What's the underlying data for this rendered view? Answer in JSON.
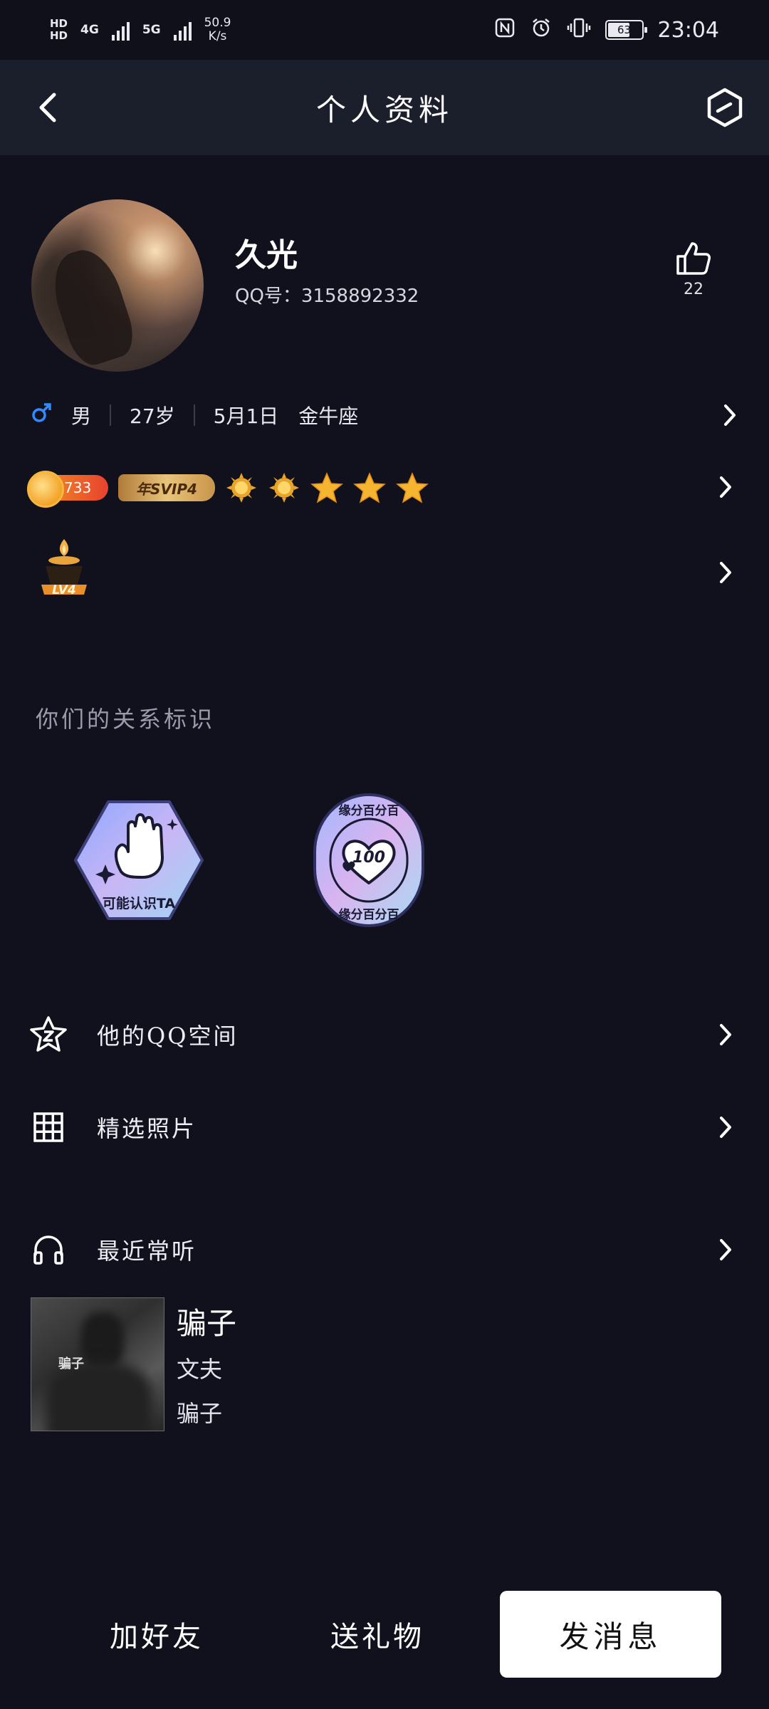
{
  "status_bar": {
    "hd1": "HD",
    "hd2": "HD",
    "net1": "4G",
    "net2": "5G",
    "speed_value": "50.9",
    "speed_unit": "K/s",
    "battery": "63",
    "time": "23:04"
  },
  "nav": {
    "title": "个人资料"
  },
  "profile": {
    "name": "久光",
    "qq_label": "QQ号：3158892332",
    "likes": "22"
  },
  "info": {
    "gender": "男",
    "age": "27岁",
    "birthday": "5月1日",
    "zodiac": "金牛座"
  },
  "badges": {
    "coin_value": "733",
    "svip": "年SVIP4",
    "level_medal": "LV4"
  },
  "relationship": {
    "section_title": "你们的关系标识",
    "tag1_label": "可能认识TA",
    "tag2_top": "缘分百分百",
    "tag2_bottom": "缘分百分百",
    "tag2_number": "100"
  },
  "menu": {
    "qzone": "他的QQ空间",
    "photos": "精选照片",
    "music": "最近常听"
  },
  "music": {
    "song": "骗子",
    "artist": "文夫",
    "album": "骗子"
  },
  "actions": {
    "add_friend": "加好友",
    "send_gift": "送礼物",
    "send_message": "发消息"
  },
  "colors": {
    "background": "#10111d",
    "nav_background": "#1b1e2b",
    "gender_male": "#2f8bff",
    "primary_button": "#ffffff"
  }
}
